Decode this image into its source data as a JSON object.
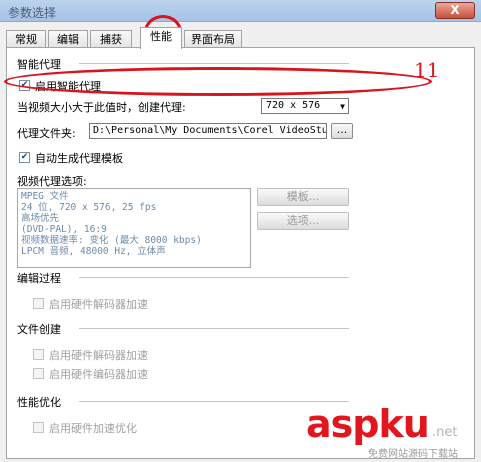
{
  "window": {
    "title": "参数选择",
    "close_label": "X"
  },
  "tabs": [
    {
      "label": "常规"
    },
    {
      "label": "编辑"
    },
    {
      "label": "捕获"
    },
    {
      "label": "性能"
    },
    {
      "label": "界面布局"
    }
  ],
  "smart_proxy": {
    "section_title": "智能代理",
    "enable_label": "启用智能代理",
    "enable_checked": true,
    "size_label": "当视频大小大于此值时，创建代理:",
    "size_value": "720 x 576",
    "folder_label": "代理文件夹:",
    "folder_value": "D:\\Personal\\My Documents\\Corel VideoStudio",
    "browse_label": "...",
    "auto_template_label": "自动生成代理模板",
    "auto_template_checked": true,
    "options_label": "视频代理选项:",
    "info_lines": [
      "MPEG 文件",
      "24 位, 720 x 576, 25 fps",
      "高场优先",
      "(DVD-PAL), 16:9",
      "视频数据速率: 变化 (最大 8000 kbps)",
      "LPCM 音频, 48000 Hz, 立体声"
    ],
    "template_button": "模板...",
    "options_button": "选项..."
  },
  "edit_process": {
    "section_title": "编辑过程",
    "hw_decoder_label": "启用硬件解码器加速"
  },
  "file_creation": {
    "section_title": "文件创建",
    "hw_decoder_label": "启用硬件解码器加速",
    "hw_encoder_label": "启用硬件编码器加速"
  },
  "perf_optimization": {
    "section_title": "性能优化",
    "hw_accel_label": "启用硬件加速优化"
  },
  "annotation": {
    "number": "11"
  },
  "watermark": {
    "logo": "aspku",
    "domain": ".net",
    "tagline": "免费网站源码下载站"
  },
  "colors": {
    "annotation_red": "#d8141c",
    "info_text": "#6e8aa8",
    "title_bar": "#bcd3ee"
  }
}
